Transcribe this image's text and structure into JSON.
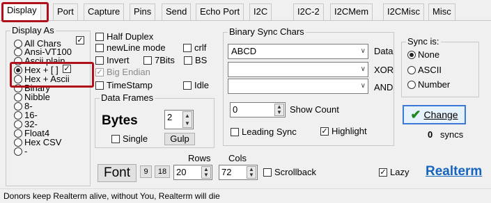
{
  "tabs": [
    "Display",
    "Port",
    "Capture",
    "Pins",
    "Send",
    "Echo Port",
    "I2C",
    "I2C-2",
    "I2CMem",
    "I2CMisc",
    "Misc"
  ],
  "display_as": {
    "title": "Display As",
    "options": [
      "All Chars",
      "Ansi-VT100",
      "Ascii plain",
      "Hex + [ ]",
      "Hex + Ascii",
      "Binary",
      "Nibble",
      "8-",
      "16-",
      "32-",
      "Float4",
      "Hex CSV",
      "-"
    ],
    "selected": "Hex + [ ]"
  },
  "checks": {
    "half_duplex": "Half Duplex",
    "newline_mode": "newLine mode",
    "crlf": "crlf",
    "invert": "Invert",
    "seven_bits": "7Bits",
    "bs": "BS",
    "big_endian": "Big Endian",
    "timestamp": "TimeStamp",
    "idle": "Idle"
  },
  "data_frames": {
    "title": "Data Frames",
    "bytes_label": "Bytes",
    "bytes_value": "2",
    "single": "Single",
    "gulp": "Gulp"
  },
  "binary_sync": {
    "title": "Binary Sync Chars",
    "data_value": "ABCD",
    "data_label": "Data",
    "xor_value": "",
    "xor_label": "XOR",
    "and_value": "",
    "and_label": "AND",
    "count_value": "0",
    "count_label": "Show Count",
    "leading_sync": "Leading Sync",
    "highlight": "Highlight"
  },
  "sync_is": {
    "title": "Sync is:",
    "options": [
      "None",
      "ASCII",
      "Number"
    ],
    "selected": "None"
  },
  "change_button": "Change",
  "syncs_count": "0",
  "syncs_label": "syncs",
  "font_button": "Font",
  "size_9": "9",
  "size_18": "18",
  "rows_label": "Rows",
  "rows_value": "20",
  "cols_label": "Cols",
  "cols_value": "72",
  "scrollback": "Scrollback",
  "lazy": "Lazy",
  "realterm_link": "Realterm",
  "status_text": "Donors keep Realterm alive, without You, Realterm will die",
  "colors": {
    "highlight_box": "#b0101a",
    "link": "#1565c0",
    "check_green": "#1c8a1c"
  }
}
